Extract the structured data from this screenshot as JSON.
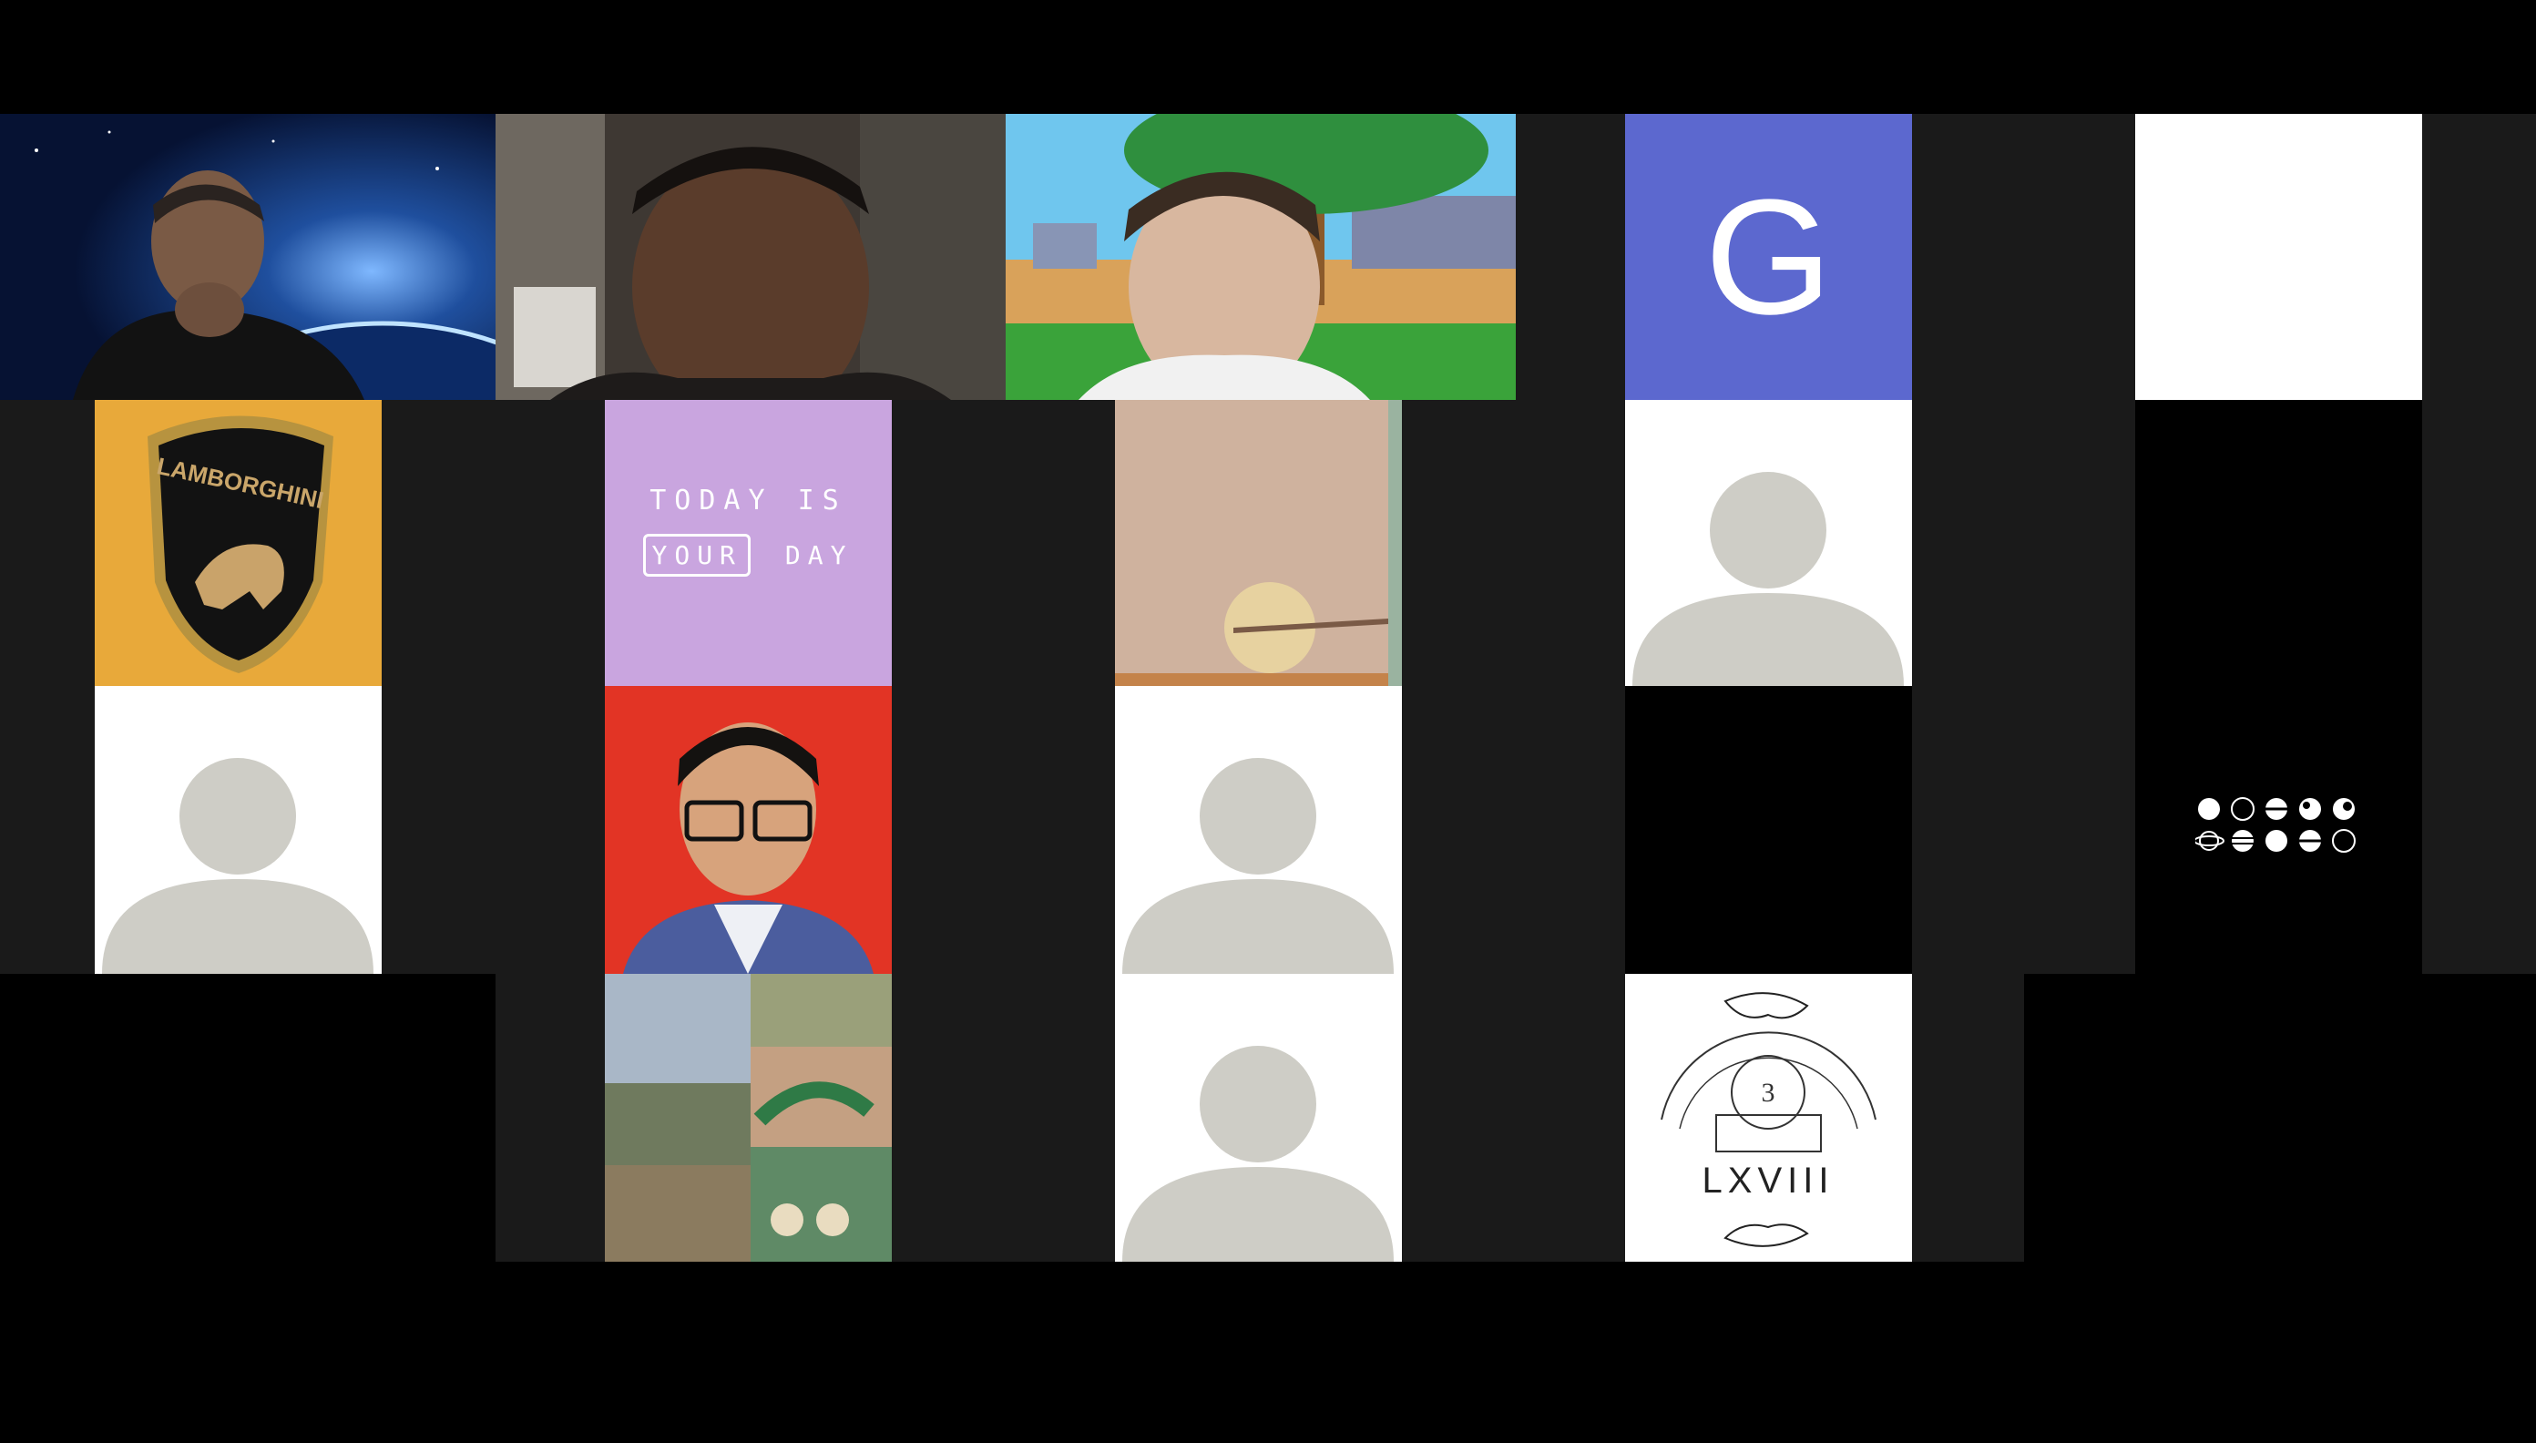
{
  "tiles": {
    "space_person": {
      "kind": "video"
    },
    "dark_room_person": {
      "kind": "video"
    },
    "cartoon_bg_person": {
      "kind": "video"
    },
    "letter_avatar": {
      "letter": "G",
      "color": "#5c68cf"
    },
    "white_tile": {
      "kind": "blank"
    },
    "lamborghini": {
      "logo_text": "LAMBORGHINI"
    },
    "today_card": {
      "line1": "TODAY IS",
      "line2_boxed": "YOUR",
      "line2_rest": "DAY",
      "color": "#c9a5df"
    },
    "sand_photo": {
      "kind": "photo"
    },
    "placeholder": {
      "kind": "default-avatar"
    },
    "black_tile": {
      "kind": "video-off"
    },
    "planets_tile": {
      "kind": "icon-grid"
    },
    "portrait_red": {
      "kind": "photo",
      "bg": "#e23425"
    },
    "collage": {
      "kind": "photo"
    },
    "emblem": {
      "numeral": "LXVIII",
      "number": "3"
    }
  }
}
